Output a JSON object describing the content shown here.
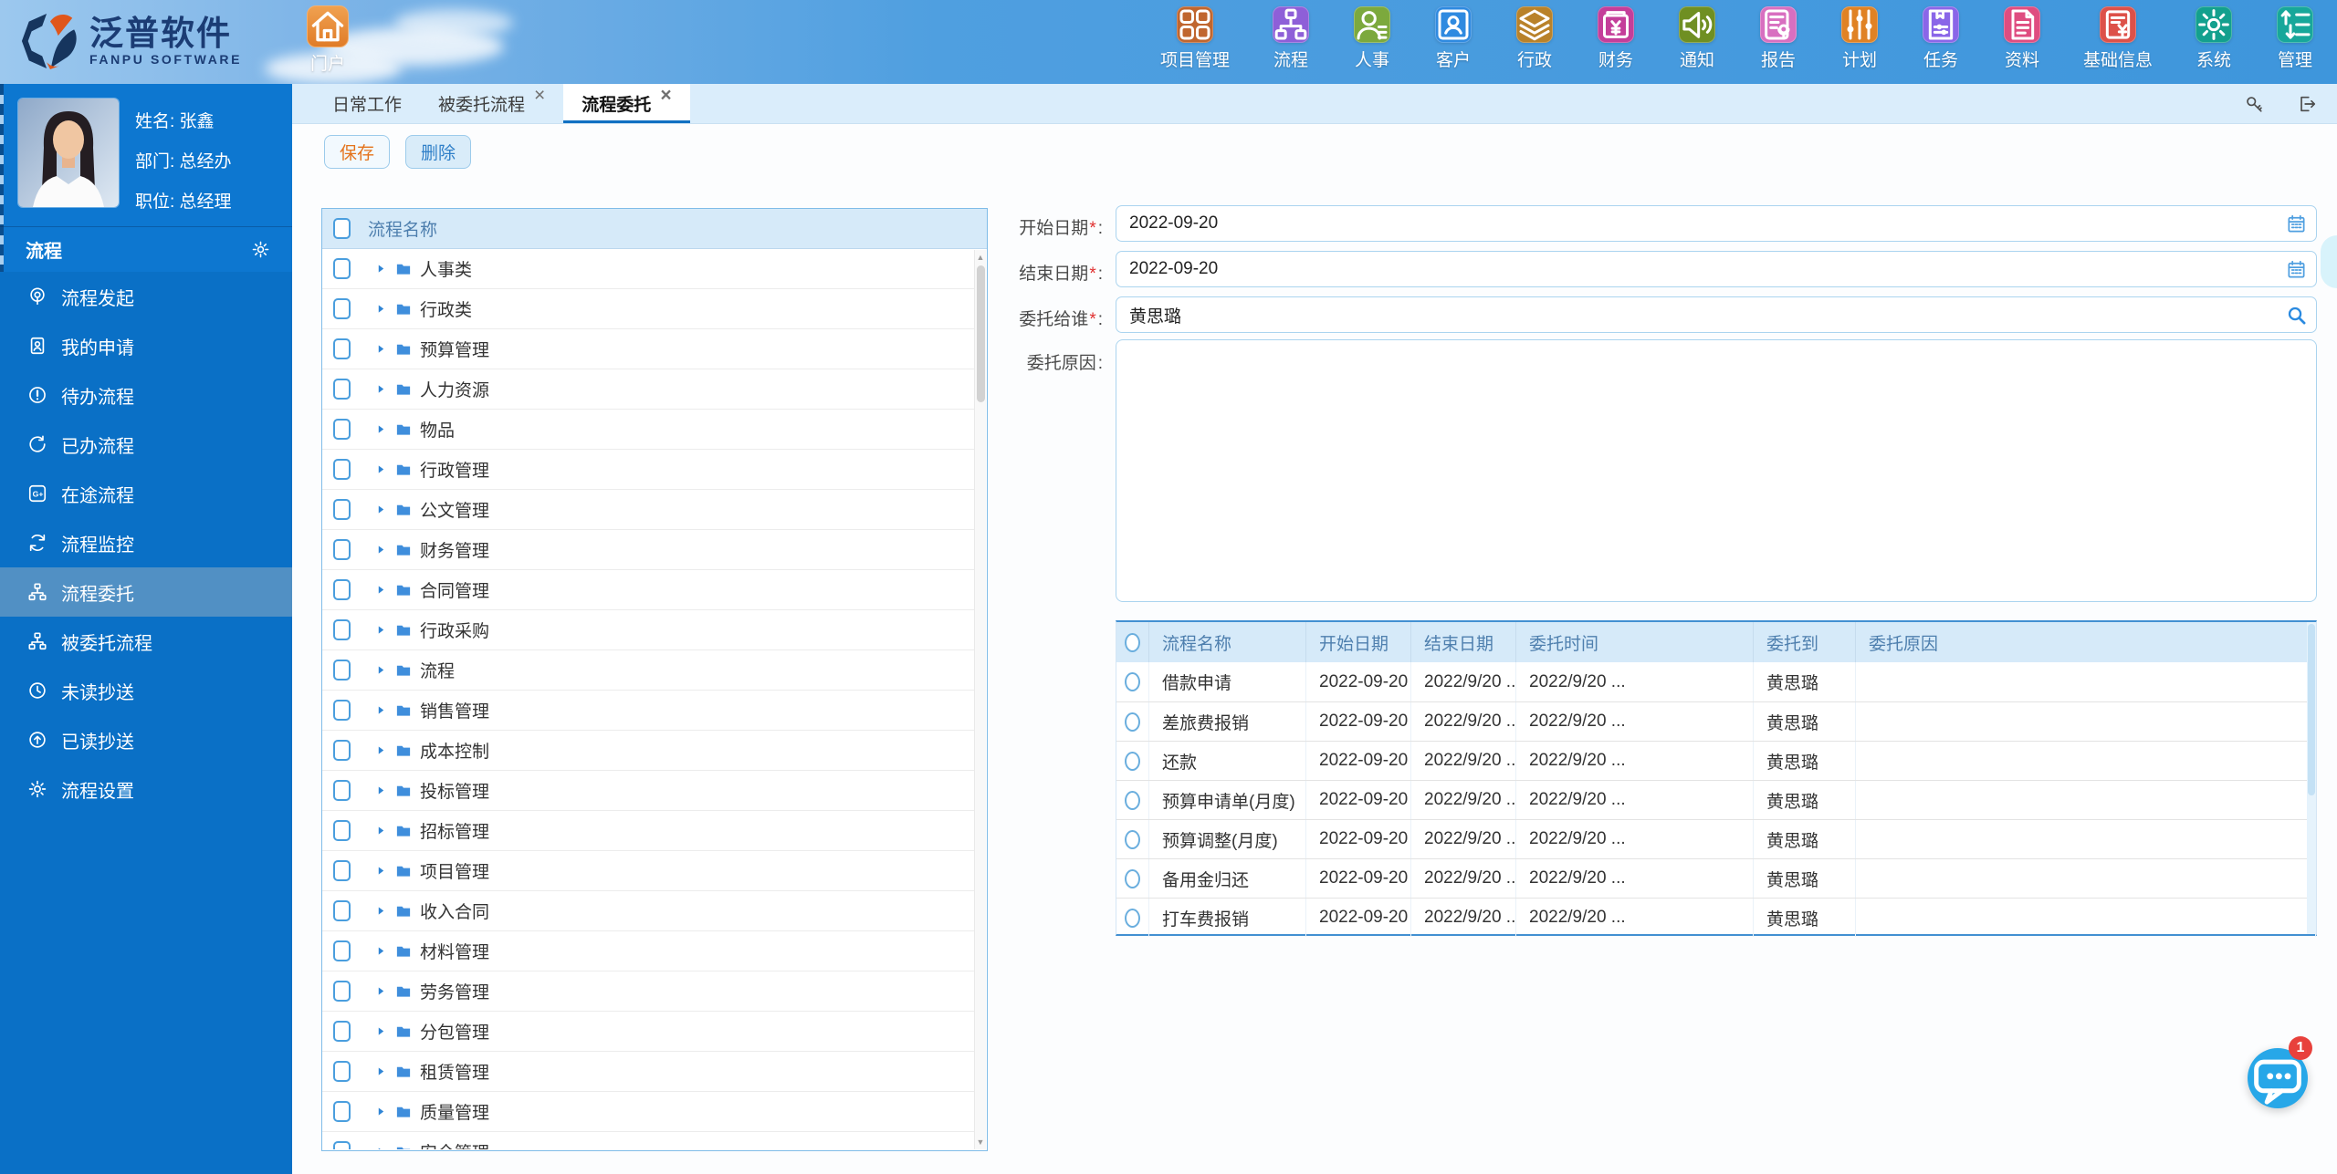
{
  "brand": {
    "name": "泛普软件",
    "subtitle": "FANPU SOFTWARE"
  },
  "portal": {
    "label": "门户",
    "icon": "home",
    "color": "#e07c28"
  },
  "top_nav": [
    {
      "label": "项目管理",
      "icon": "grid",
      "color": "#c0662f"
    },
    {
      "label": "流程",
      "icon": "sitemap",
      "color": "#8e5fd8"
    },
    {
      "label": "人事",
      "icon": "user",
      "color": "#7ca93d"
    },
    {
      "label": "客户",
      "icon": "users-card",
      "color": "#2f8ae0"
    },
    {
      "label": "行政",
      "icon": "layers",
      "color": "#b9822a"
    },
    {
      "label": "财务",
      "icon": "money",
      "color": "#c43e9a"
    },
    {
      "label": "通知",
      "icon": "speaker",
      "color": "#6f8f22"
    },
    {
      "label": "报告",
      "icon": "report-mic",
      "color": "#d86fc0"
    },
    {
      "label": "计划",
      "icon": "sliders-v",
      "color": "#e08224"
    },
    {
      "label": "任务",
      "icon": "bookmark-sliders",
      "color": "#8a66e8"
    },
    {
      "label": "资料",
      "icon": "document",
      "color": "#df4d80"
    },
    {
      "label": "基础信息",
      "icon": "invoice",
      "color": "#dd5149"
    },
    {
      "label": "系统",
      "icon": "gear",
      "color": "#13a08e"
    },
    {
      "label": "管理",
      "icon": "sort-list",
      "color": "#17a79a"
    }
  ],
  "user": {
    "name": "姓名: 张鑫",
    "dept": "部门: 总经办",
    "title": "职位: 总经理"
  },
  "sidebar": {
    "section": "流程",
    "section_icon": "gear",
    "items": [
      {
        "label": "流程发起",
        "icon": "broadcast",
        "active": false
      },
      {
        "label": "我的申请",
        "icon": "id-card",
        "active": false
      },
      {
        "label": "待办流程",
        "icon": "alert-circle",
        "active": false
      },
      {
        "label": "已办流程",
        "icon": "redo",
        "active": false
      },
      {
        "label": "在途流程",
        "icon": "gplus",
        "active": false
      },
      {
        "label": "流程监控",
        "icon": "refresh",
        "active": false
      },
      {
        "label": "流程委托",
        "icon": "sitemap",
        "active": true
      },
      {
        "label": "被委托流程",
        "icon": "sitemap",
        "active": false
      },
      {
        "label": "未读抄送",
        "icon": "clock",
        "active": false
      },
      {
        "label": "已读抄送",
        "icon": "arrow-up-circle",
        "active": false
      },
      {
        "label": "流程设置",
        "icon": "gear",
        "active": false
      }
    ]
  },
  "tabs": [
    {
      "label": "日常工作",
      "closable": false,
      "active": false
    },
    {
      "label": "被委托流程",
      "closable": true,
      "active": false
    },
    {
      "label": "流程委托",
      "closable": true,
      "active": true
    }
  ],
  "window_actions": [
    "key",
    "logout"
  ],
  "toolbar": {
    "save": "保存",
    "delete": "删除"
  },
  "tree": {
    "header": "流程名称",
    "expander_icon": "caret-right",
    "item_icon": "folder",
    "items": [
      "人事类",
      "行政类",
      "预算管理",
      "人力资源",
      "物品",
      "行政管理",
      "公文管理",
      "财务管理",
      "合同管理",
      "行政采购",
      "流程",
      "销售管理",
      "成本控制",
      "投标管理",
      "招标管理",
      "项目管理",
      "收入合同",
      "材料管理",
      "劳务管理",
      "分包管理",
      "租赁管理",
      "质量管理",
      "安全管理"
    ]
  },
  "form": {
    "fields": [
      {
        "label": "开始日期",
        "required": true,
        "value": "2022-09-20",
        "icon": "calendar"
      },
      {
        "label": "结束日期",
        "required": true,
        "value": "2022-09-20",
        "icon": "calendar"
      },
      {
        "label": "委托给谁",
        "required": true,
        "value": "黄思璐",
        "icon": "search"
      }
    ],
    "reason": {
      "label": "委托原因",
      "value": ""
    }
  },
  "table": {
    "columns": [
      "流程名称",
      "开始日期",
      "结束日期",
      "委托时间",
      "委托到",
      "委托原因"
    ],
    "rows": [
      {
        "name": "借款申请",
        "start": "2022-09-20",
        "end": "2022/9/20 ...",
        "time": "2022/9/20 ...",
        "to": "黄思璐",
        "reason": ""
      },
      {
        "name": "差旅费报销",
        "start": "2022-09-20",
        "end": "2022/9/20 ...",
        "time": "2022/9/20 ...",
        "to": "黄思璐",
        "reason": ""
      },
      {
        "name": "还款",
        "start": "2022-09-20",
        "end": "2022/9/20 ...",
        "time": "2022/9/20 ...",
        "to": "黄思璐",
        "reason": ""
      },
      {
        "name": "预算申请单(月度)",
        "start": "2022-09-20",
        "end": "2022/9/20 ...",
        "time": "2022/9/20 ...",
        "to": "黄思璐",
        "reason": ""
      },
      {
        "name": "预算调整(月度)",
        "start": "2022-09-20",
        "end": "2022/9/20 ...",
        "time": "2022/9/20 ...",
        "to": "黄思璐",
        "reason": ""
      },
      {
        "name": "备用金归还",
        "start": "2022-09-20",
        "end": "2022/9/20 ...",
        "time": "2022/9/20 ...",
        "to": "黄思璐",
        "reason": ""
      },
      {
        "name": "打车费报销",
        "start": "2022-09-20",
        "end": "2022/9/20 ...",
        "time": "2022/9/20 ...",
        "to": "黄思璐",
        "reason": ""
      }
    ]
  },
  "chat": {
    "badge": "1",
    "icon": "chat"
  }
}
